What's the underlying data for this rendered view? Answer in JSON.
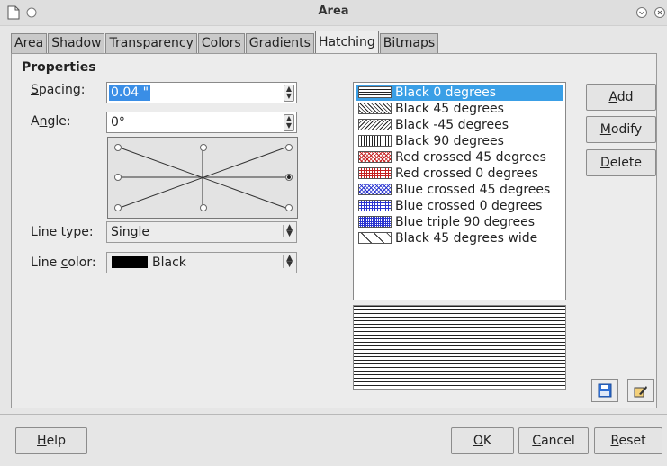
{
  "window": {
    "title": "Area"
  },
  "tabs": [
    {
      "label": "Area",
      "active": false
    },
    {
      "label": "Shadow",
      "active": false
    },
    {
      "label": "Transparency",
      "active": false
    },
    {
      "label": "Colors",
      "active": false
    },
    {
      "label": "Gradients",
      "active": false
    },
    {
      "label": "Hatching",
      "active": true
    },
    {
      "label": "Bitmaps",
      "active": false
    }
  ],
  "properties": {
    "heading": "Properties",
    "spacing": {
      "label": "Spacing:",
      "value": "0.04 \""
    },
    "angle": {
      "label": "Angle:",
      "value": "0°"
    },
    "angle_preset_selected": "right",
    "line_type": {
      "label": "Line type:",
      "value": "Single"
    },
    "line_color": {
      "label": "Line color:",
      "value": "Black",
      "swatch": "#000000"
    }
  },
  "hatch_list": [
    {
      "label": "Black 0 degrees",
      "selected": true
    },
    {
      "label": "Black 45 degrees",
      "selected": false
    },
    {
      "label": "Black -45 degrees",
      "selected": false
    },
    {
      "label": "Black 90 degrees",
      "selected": false
    },
    {
      "label": "Red crossed 45 degrees",
      "selected": false
    },
    {
      "label": "Red crossed 0 degrees",
      "selected": false
    },
    {
      "label": "Blue crossed 45 degrees",
      "selected": false
    },
    {
      "label": "Blue crossed 0 degrees",
      "selected": false
    },
    {
      "label": "Blue triple 90 degrees",
      "selected": false
    },
    {
      "label": "Black 45 degrees wide",
      "selected": false
    }
  ],
  "side_buttons": {
    "add": "Add",
    "modify": "Modify",
    "delete": "Delete"
  },
  "footer": {
    "help": "Help",
    "ok": "OK",
    "cancel": "Cancel",
    "reset": "Reset"
  },
  "colors": {
    "selection": "#3a9fe6",
    "red": "#c42020",
    "blue": "#2a34d0"
  }
}
